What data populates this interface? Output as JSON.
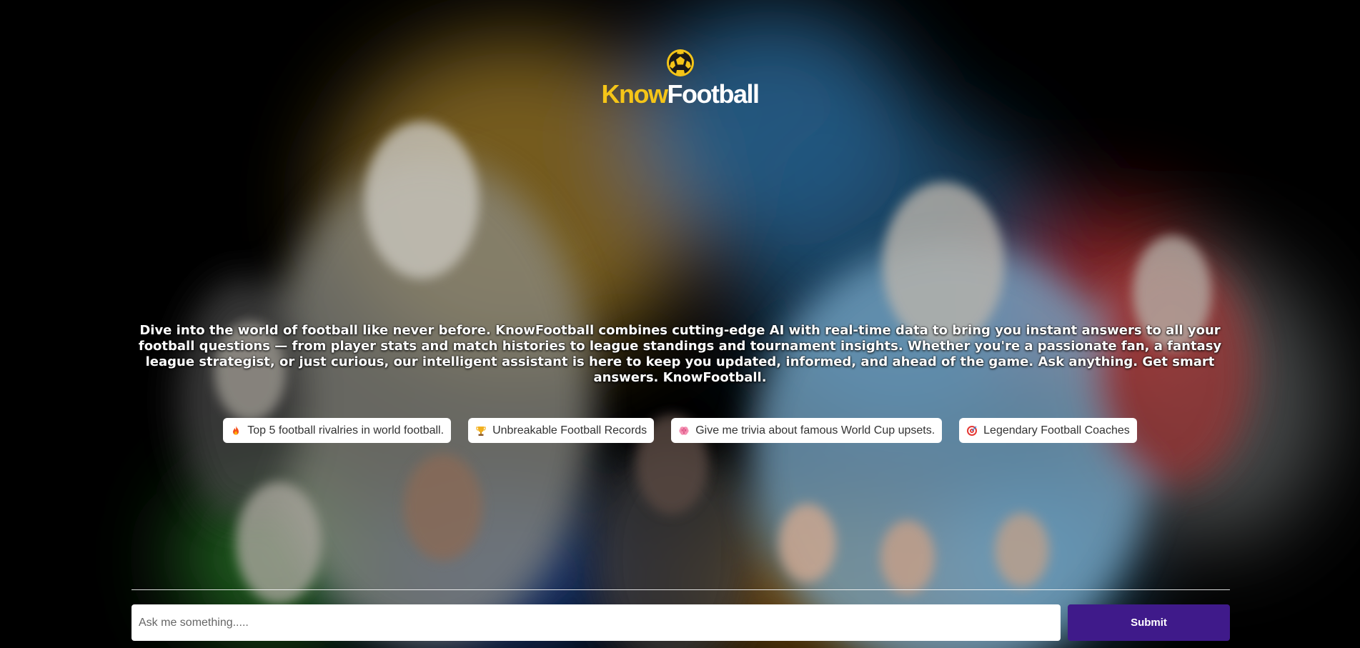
{
  "brand": {
    "name_part1": "Know",
    "name_part2": "Football",
    "accent_color": "#f5c518",
    "logo_icon": "soccer-ball-icon"
  },
  "hero": {
    "description": "Dive into the world of football like never before. KnowFootball combines cutting-edge AI with real-time data to bring you instant answers to all your football questions — from player stats and match histories to league standings and tournament insights. Whether you're a passionate fan, a fantasy league strategist, or just curious, our intelligent assistant is here to keep you updated, informed, and ahead of the game. Ask anything. Get smart answers. KnowFootball."
  },
  "suggestions": [
    {
      "icon": "fire-icon",
      "label": "Top 5 football rivalries in world football."
    },
    {
      "icon": "trophy-icon",
      "label": "Unbreakable Football Records"
    },
    {
      "icon": "brain-icon",
      "label": "Give me trivia about famous World Cup upsets."
    },
    {
      "icon": "target-icon",
      "label": "Legendary Football Coaches"
    }
  ],
  "ask": {
    "placeholder": "Ask me something.....",
    "value": "",
    "submit_label": "Submit",
    "submit_color": "#3f1a8a"
  }
}
